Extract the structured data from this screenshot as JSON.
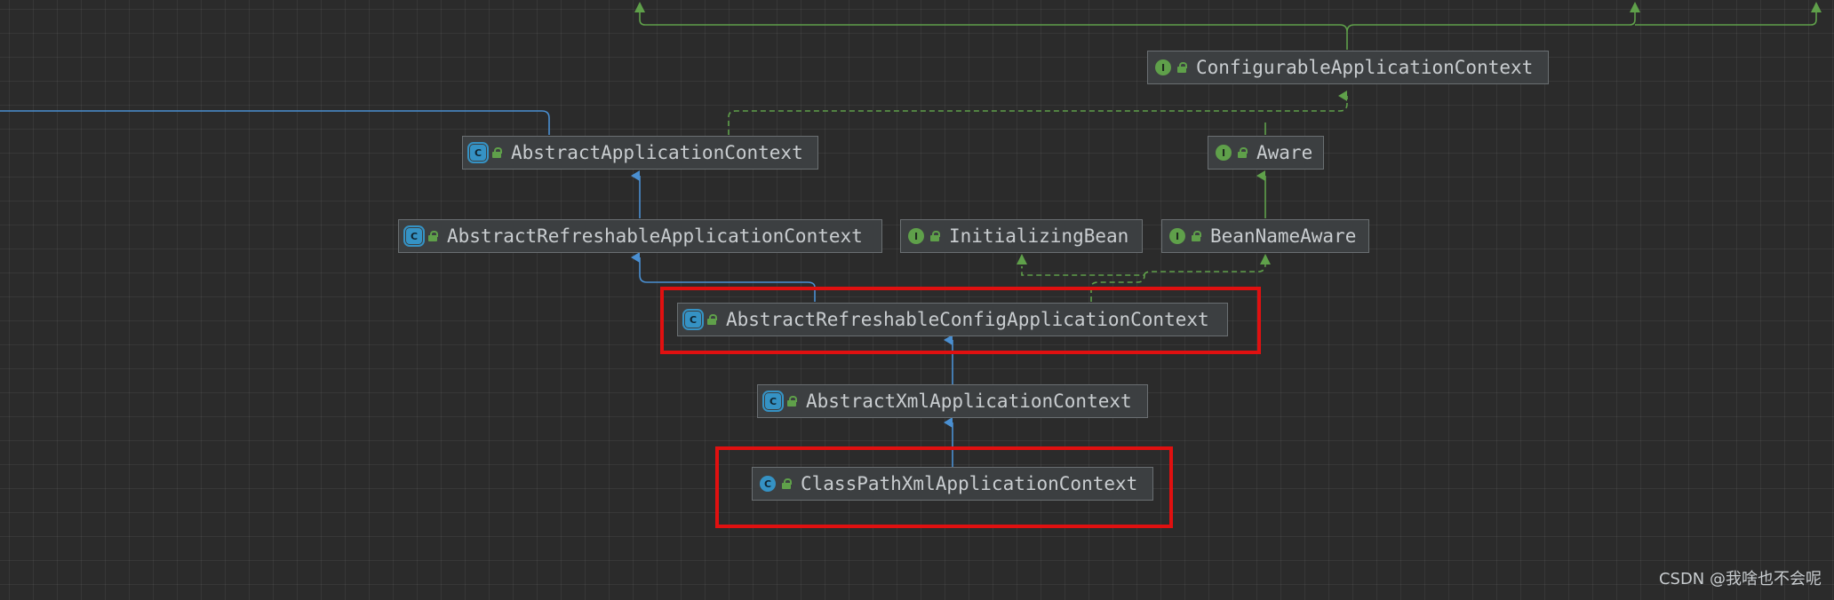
{
  "colors": {
    "background": "#2b2b2b",
    "node_fill": "#3c3f41",
    "node_border": "#6a6f72",
    "node_text": "#c9cdd0",
    "extends_edge": "#4a8fd1",
    "implements_edge": "#5fa04a",
    "highlight": "#e01010"
  },
  "nodes": {
    "configurable_application_context": {
      "label": "ConfigurableApplicationContext",
      "kind": "interface",
      "kind_letter": "I",
      "icon": "interface-icon"
    },
    "abstract_application_context": {
      "label": "AbstractApplicationContext",
      "kind": "abstract-class",
      "kind_letter": "C",
      "icon": "abstract-class-icon"
    },
    "aware": {
      "label": "Aware",
      "kind": "interface",
      "kind_letter": "I",
      "icon": "interface-icon"
    },
    "abstract_refreshable_application_context": {
      "label": "AbstractRefreshableApplicationContext",
      "kind": "abstract-class",
      "kind_letter": "C",
      "icon": "abstract-class-icon"
    },
    "initializing_bean": {
      "label": "InitializingBean",
      "kind": "interface",
      "kind_letter": "I",
      "icon": "interface-icon"
    },
    "bean_name_aware": {
      "label": "BeanNameAware",
      "kind": "interface",
      "kind_letter": "I",
      "icon": "interface-icon"
    },
    "abstract_refreshable_config_application_context": {
      "label": "AbstractRefreshableConfigApplicationContext",
      "kind": "abstract-class",
      "kind_letter": "C",
      "icon": "abstract-class-icon"
    },
    "abstract_xml_application_context": {
      "label": "AbstractXmlApplicationContext",
      "kind": "abstract-class",
      "kind_letter": "C",
      "icon": "abstract-class-icon"
    },
    "class_path_xml_application_context": {
      "label": "ClassPathXmlApplicationContext",
      "kind": "class",
      "kind_letter": "C",
      "icon": "class-icon"
    }
  },
  "highlighted_nodes": [
    "abstract_refreshable_config_application_context",
    "class_path_xml_application_context"
  ],
  "edges": [
    {
      "from": "abstract_application_context",
      "to": "configurable_application_context",
      "type": "implements"
    },
    {
      "from": "aware",
      "to": null,
      "type": "implements"
    },
    {
      "from": "abstract_refreshable_application_context",
      "to": "abstract_application_context",
      "type": "extends"
    },
    {
      "from": "bean_name_aware",
      "to": "aware",
      "type": "extends"
    },
    {
      "from": "abstract_refreshable_config_application_context",
      "to": "abstract_refreshable_application_context",
      "type": "extends"
    },
    {
      "from": "abstract_refreshable_config_application_context",
      "to": "initializing_bean",
      "type": "implements"
    },
    {
      "from": "abstract_refreshable_config_application_context",
      "to": "bean_name_aware",
      "type": "implements"
    },
    {
      "from": "abstract_xml_application_context",
      "to": "abstract_refreshable_config_application_context",
      "type": "extends"
    },
    {
      "from": "class_path_xml_application_context",
      "to": "abstract_xml_application_context",
      "type": "extends"
    }
  ],
  "watermark": "CSDN @我啥也不会呢"
}
